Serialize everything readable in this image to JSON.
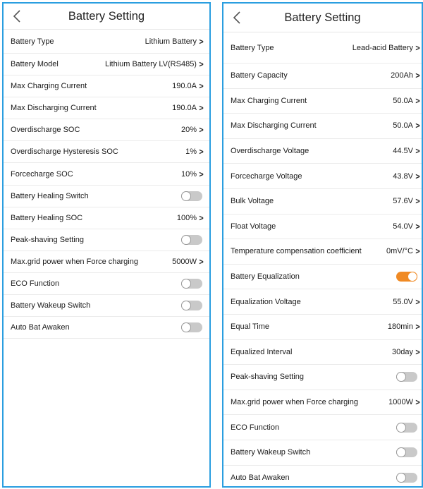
{
  "left_panel": {
    "title": "Battery Setting",
    "rows": [
      {
        "label": "Battery Type",
        "type": "value",
        "value": "Lithium Battery",
        "chevron": ">"
      },
      {
        "label": "Battery Model",
        "type": "value",
        "value": "Lithium Battery LV(RS485)",
        "chevron": ">"
      },
      {
        "label": "Max Charging Current",
        "type": "value",
        "value": "190.0A",
        "chevron": ">"
      },
      {
        "label": "Max Discharging Current",
        "type": "value",
        "value": "190.0A",
        "chevron": ">"
      },
      {
        "label": "Overdischarge SOC",
        "type": "value",
        "value": "20%",
        "chevron": ">"
      },
      {
        "label": "Overdischarge Hysteresis SOC",
        "type": "value",
        "value": "1%",
        "chevron": ">"
      },
      {
        "label": "Forcecharge SOC",
        "type": "value",
        "value": "10%",
        "chevron": ">"
      },
      {
        "label": "Battery Healing Switch",
        "type": "toggle",
        "on": false
      },
      {
        "label": "Battery Healing SOC",
        "type": "value",
        "value": "100%",
        "chevron": ">"
      },
      {
        "label": "Peak-shaving Setting",
        "type": "toggle",
        "on": false
      },
      {
        "label": "Max.grid power when Force charging",
        "type": "value",
        "value": "5000W",
        "chevron": ">"
      },
      {
        "label": "ECO Function",
        "type": "toggle",
        "on": false
      },
      {
        "label": "Battery Wakeup Switch",
        "type": "toggle",
        "on": false
      },
      {
        "label": "Auto Bat Awaken",
        "type": "toggle",
        "on": false
      }
    ]
  },
  "right_panel": {
    "title": "Battery Setting",
    "rows": [
      {
        "label": "Battery Type",
        "type": "value",
        "value": "Lead-acid Battery",
        "chevron": ">"
      },
      {
        "label": "Battery Capacity",
        "type": "value",
        "value": "200Ah",
        "chevron": ">"
      },
      {
        "label": "Max Charging Current",
        "type": "value",
        "value": "50.0A",
        "chevron": ">"
      },
      {
        "label": "Max Discharging Current",
        "type": "value",
        "value": "50.0A",
        "chevron": ">"
      },
      {
        "label": "Overdischarge Voltage",
        "type": "value",
        "value": "44.5V",
        "chevron": ">"
      },
      {
        "label": "Forcecharge Voltage",
        "type": "value",
        "value": "43.8V",
        "chevron": ">"
      },
      {
        "label": "Bulk Voltage",
        "type": "value",
        "value": "57.6V",
        "chevron": ">"
      },
      {
        "label": "Float Voltage",
        "type": "value",
        "value": "54.0V",
        "chevron": ">"
      },
      {
        "label": "Temperature compensation coefficient",
        "type": "value",
        "value": "0mV/°C",
        "chevron": ">"
      },
      {
        "label": "Battery Equalization",
        "type": "toggle",
        "on": true
      },
      {
        "label": "Equalization Voltage",
        "type": "value",
        "value": "55.0V",
        "chevron": ">"
      },
      {
        "label": "Equal Time",
        "type": "value",
        "value": "180min",
        "chevron": ">"
      },
      {
        "label": "Equalized Interval",
        "type": "value",
        "value": "30day",
        "chevron": ">"
      },
      {
        "label": "Peak-shaving Setting",
        "type": "toggle",
        "on": false
      },
      {
        "label": "Max.grid power when Force charging",
        "type": "value",
        "value": "1000W",
        "chevron": ">"
      },
      {
        "label": "ECO Function",
        "type": "toggle",
        "on": false
      },
      {
        "label": "Battery Wakeup Switch",
        "type": "toggle",
        "on": false
      },
      {
        "label": "Auto Bat Awaken",
        "type": "toggle",
        "on": false
      }
    ]
  },
  "colors": {
    "panel_border": "#2a9ee0",
    "toggle_on": "#f08a24",
    "toggle_off": "#c9c9c9"
  },
  "icons": {
    "back": "chevron-left-icon"
  }
}
